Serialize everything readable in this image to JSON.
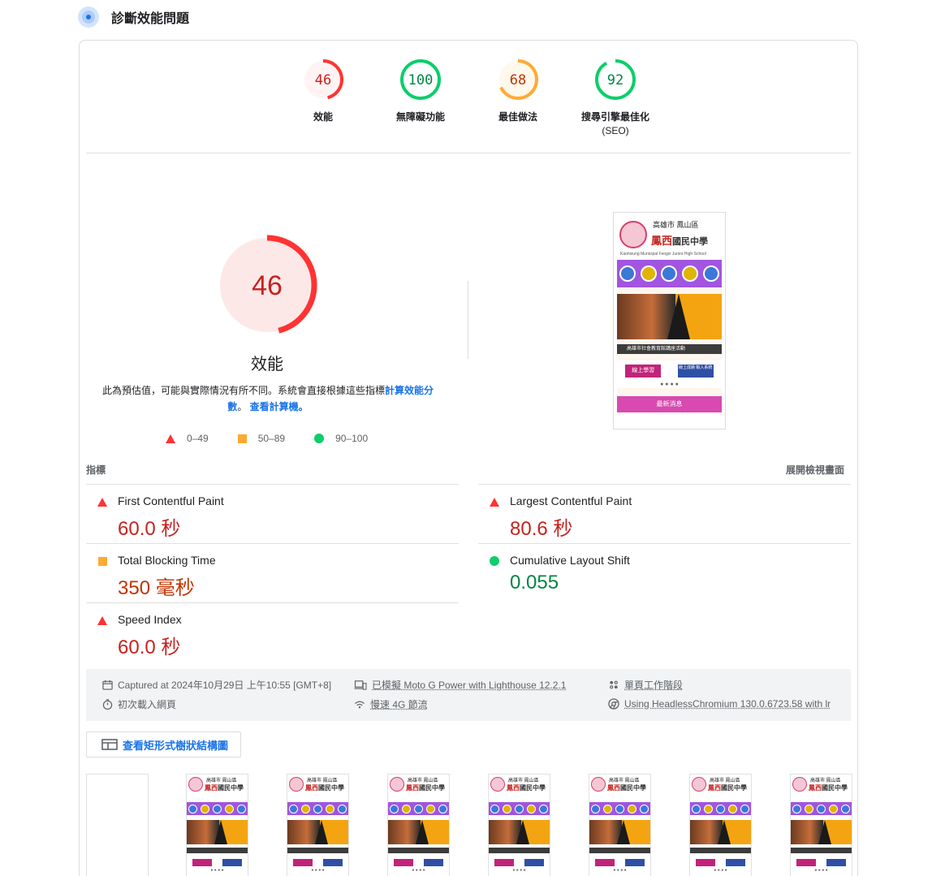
{
  "header": {
    "title": "診斷效能問題",
    "icon": "lighthouse-icon"
  },
  "gauges": [
    {
      "score": "46",
      "label": "效能",
      "sub": "",
      "level": 0.46,
      "color": "#ff3333",
      "bg": "#fff3f3",
      "text": "#c5221f"
    },
    {
      "score": "100",
      "label": "無障礙功能",
      "sub": "",
      "level": 1.0,
      "color": "#0cce6b",
      "bg": "#ffffff",
      "text": "#018642"
    },
    {
      "score": "68",
      "label": "最佳做法",
      "sub": "",
      "level": 0.68,
      "color": "#ffaa33",
      "bg": "#fff8ec",
      "text": "#c33300"
    },
    {
      "score": "92",
      "label": "搜尋引擎最佳化",
      "sub": "(SEO)",
      "level": 0.92,
      "color": "#0cce6b",
      "bg": "#ffffff",
      "text": "#018642"
    }
  ],
  "performance": {
    "score": "46",
    "level": 0.46,
    "title": "效能",
    "desc_prefix": "此為預估值，可能與實際情況有所不同。系統會直接根據這些指標",
    "desc_link1": "計算效能分數",
    "desc_mid": "。",
    "desc_link2": "查看計算機。",
    "legend": [
      {
        "shape": "triangle",
        "label": "0–49"
      },
      {
        "shape": "square",
        "label": "50–89"
      },
      {
        "shape": "circle",
        "label": "90–100"
      }
    ]
  },
  "metrics_header": {
    "label": "指標",
    "expand": "展開檢視畫面"
  },
  "metrics": [
    {
      "name": "First Contentful Paint",
      "value": "60.0 秒",
      "rating": "fail"
    },
    {
      "name": "Largest Contentful Paint",
      "value": "80.6 秒",
      "rating": "fail"
    },
    {
      "name": "Total Blocking Time",
      "value": "350 毫秒",
      "rating": "average"
    },
    {
      "name": "Cumulative Layout Shift",
      "value": "0.055",
      "rating": "pass"
    },
    {
      "name": "Speed Index",
      "value": "60.0 秒",
      "rating": "fail"
    }
  ],
  "runtime": {
    "captured": "Captured at 2024年10月29日 上午10:55 [GMT+8]",
    "initial": "初次載入網頁",
    "device": "已模擬 Moto G Power with Lighthouse 12.2.1",
    "network": "慢速 4G 節流",
    "session": "單頁工作階段",
    "browser": "Using HeadlessChromium 130.0.6723.58 with lr"
  },
  "treemap": {
    "label": "查看矩形式樹狀結構圖"
  },
  "site_preview": {
    "city": "高雄市 鳳山區",
    "name_a": "鳳西",
    "name_b": "國民中學",
    "english": "Kaohsiung Municipal Fengxi Junior High School",
    "news": "高雄市社會教育館講座活動",
    "btn1": "線上學習",
    "btn2": "線上成績 輸入系統",
    "latest": "最新消息"
  }
}
